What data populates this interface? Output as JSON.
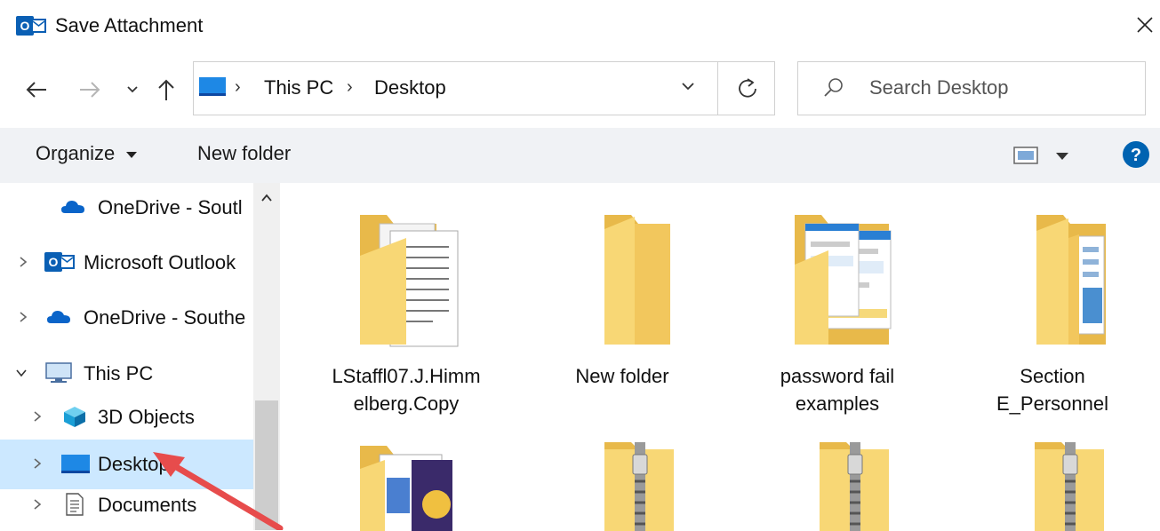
{
  "window": {
    "title": "Save Attachment",
    "app_icon": "outlook-icon",
    "close_icon": "close-icon"
  },
  "navigation": {
    "back_icon": "arrow-left-icon",
    "forward_icon": "arrow-right-icon",
    "recent_icon": "chevron-down-icon",
    "up_icon": "arrow-up-icon",
    "breadcrumbs": [
      "This PC",
      "Desktop"
    ],
    "refresh_icon": "refresh-icon",
    "search_placeholder": "Search Desktop"
  },
  "commandbar": {
    "organize_label": "Organize",
    "new_folder_label": "New folder",
    "view_icon": "view-options-icon",
    "help_icon": "help-icon"
  },
  "nav_pane": {
    "items": [
      {
        "label": "OneDrive - Soutl",
        "icon": "onedrive-icon",
        "expandable": false
      },
      {
        "label": "Microsoft Outlook",
        "icon": "outlook-icon",
        "expandable": true
      },
      {
        "label": "OneDrive - Southe",
        "icon": "onedrive-icon",
        "expandable": true
      },
      {
        "label": "This PC",
        "icon": "pc-icon",
        "expandable": true,
        "expanded": true
      },
      {
        "label": "3D Objects",
        "icon": "3d-objects-icon",
        "expandable": true
      },
      {
        "label": "Desktop",
        "icon": "desktop-icon",
        "expandable": true,
        "selected": true
      },
      {
        "label": "Documents",
        "icon": "documents-icon",
        "expandable": true
      }
    ]
  },
  "files": [
    {
      "name": "LStaffl07.J.Himm\nelberg.Copy",
      "type": "folder-docs"
    },
    {
      "name": "New folder",
      "type": "folder-empty"
    },
    {
      "name": "password fail\nexamples",
      "type": "folder-screens"
    },
    {
      "name": "Section\nE_Personnel",
      "type": "folder-pictures"
    },
    {
      "name": "",
      "type": "folder-docs-purple"
    },
    {
      "name": "",
      "type": "zip-folder"
    },
    {
      "name": "",
      "type": "zip-folder"
    },
    {
      "name": "",
      "type": "zip-folder"
    }
  ],
  "colors": {
    "selection": "#cce8ff",
    "folder": "#f8d775",
    "folder_dark": "#e8b94a",
    "accent": "#0063b1",
    "arrow": "#e74c4c"
  }
}
